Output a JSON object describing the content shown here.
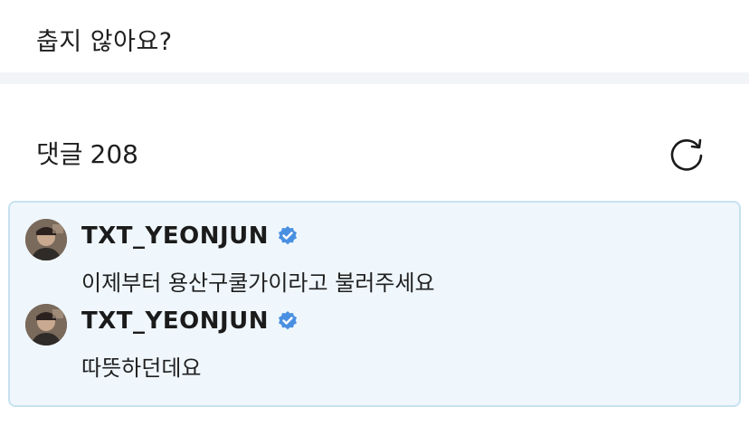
{
  "post": {
    "text": "춥지 않아요?"
  },
  "comments": {
    "label": "댓글",
    "count": "208",
    "refresh_icon": "refresh-icon",
    "items": [
      {
        "username": "TXT_YEONJUN",
        "verified_icon": "verified-badge-icon",
        "text": "이제부터 용산구쿨가이라고 불러주세요"
      },
      {
        "username": "TXT_YEONJUN",
        "verified_icon": "verified-badge-icon",
        "text": "따뜻하던데요"
      }
    ]
  },
  "colors": {
    "highlight_bg": "#eff7fd",
    "highlight_border": "#c7e1f0",
    "verified": "#4a90e2",
    "divider": "#f2f4f8"
  }
}
